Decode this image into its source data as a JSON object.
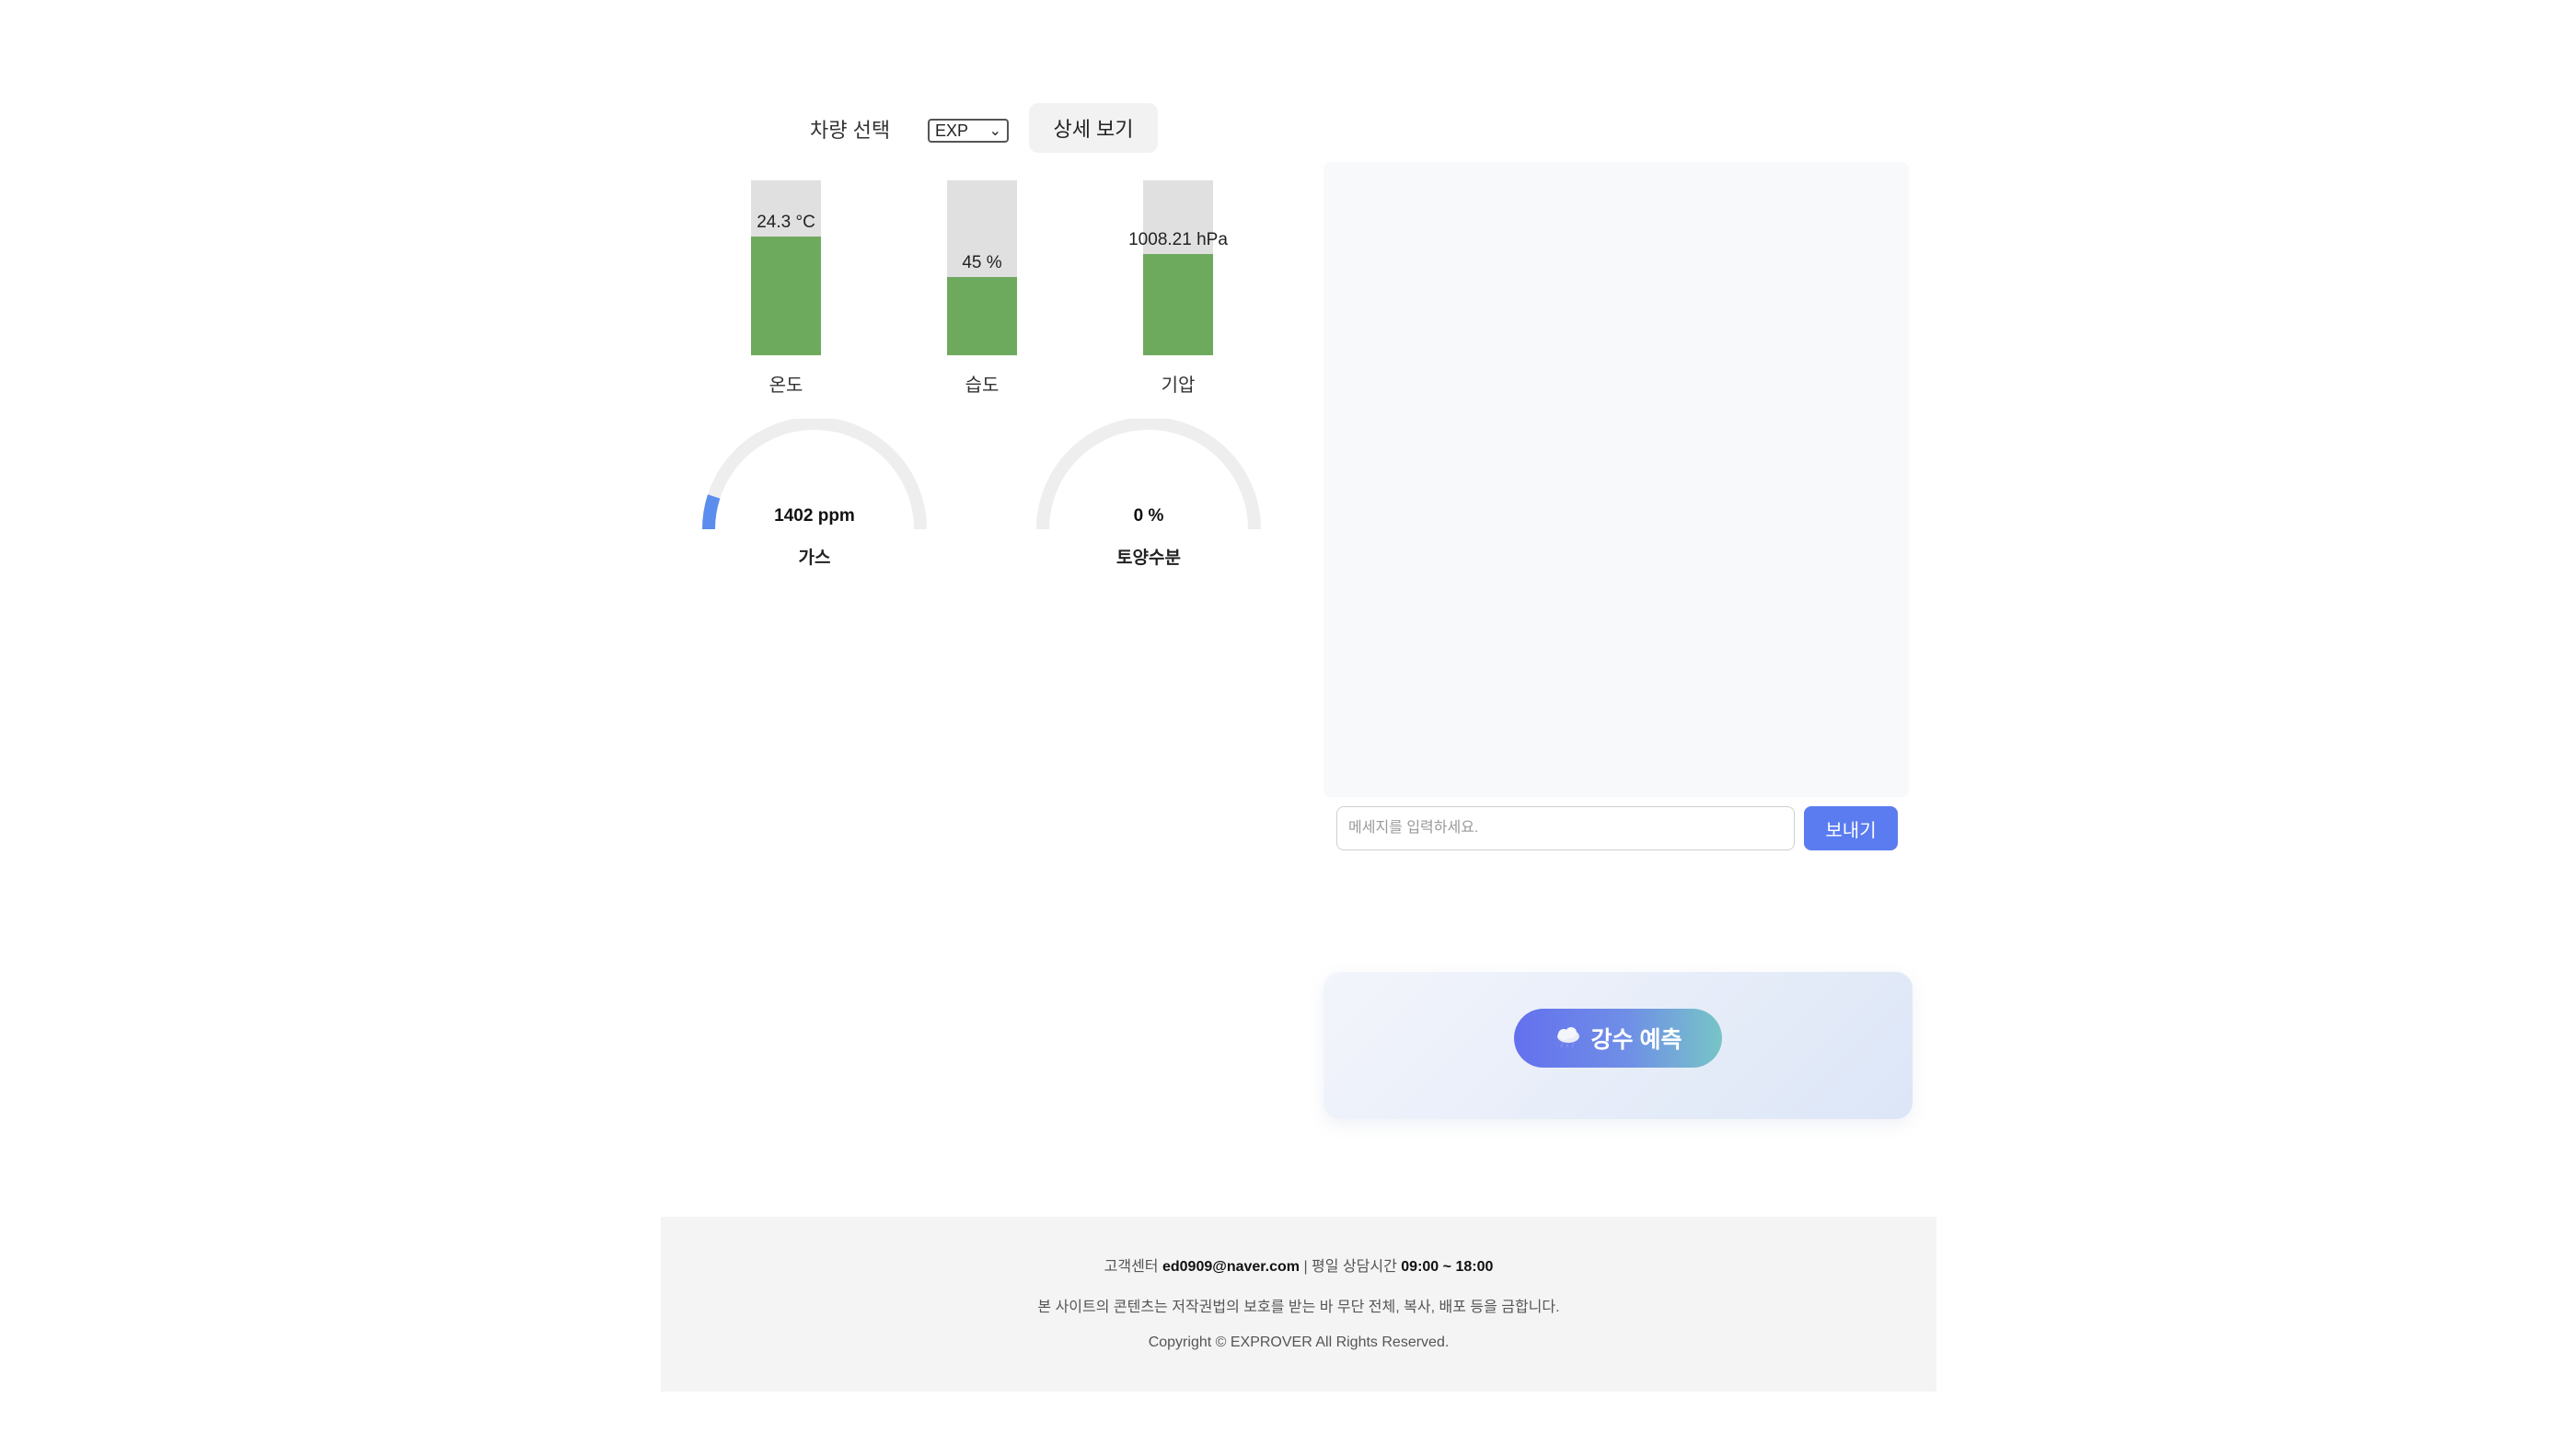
{
  "controls": {
    "vehicle_label": "차량 선택",
    "vehicle_selected": "EXP",
    "detail_button": "상세 보기"
  },
  "sensors": {
    "temperature": {
      "value_text": "24.3 °C",
      "label": "온도",
      "level": 0.68
    },
    "humidity": {
      "value_text": "45 %",
      "label": "습도",
      "level": 0.45
    },
    "pressure": {
      "value_text": "1008.21 hPa",
      "label": "기압",
      "level": 0.58
    }
  },
  "gauges": {
    "gas": {
      "value_text": "1402 ppm",
      "label": "가스",
      "level": 0.1
    },
    "soil": {
      "value_text": "0 %",
      "label": "토양수분",
      "level": 0
    }
  },
  "chat": {
    "input_placeholder": "메세지를 입력하세요.",
    "send_label": "보내기"
  },
  "rain": {
    "button_label": "강수 예측",
    "icon": "cloud-rain-icon"
  },
  "footer": {
    "support_label": "고객센터",
    "support_email": "ed0909@naver.com",
    "hours_label": "| 평일 상담시간",
    "hours": "09:00 ~ 18:00",
    "notice": "본 사이트의 콘텐츠는 저작권법의 보호를 받는 바 무단 전체, 복사, 배포 등을 금합니다.",
    "copyright": "Copyright © EXPROVER All Rights Reserved."
  },
  "colors": {
    "bar_fill": "#6eaa5e",
    "bar_track": "#e0e0e0",
    "gauge_active": "#5b8def",
    "gauge_track": "#eeeeee",
    "send_button": "#5b7cf0"
  }
}
